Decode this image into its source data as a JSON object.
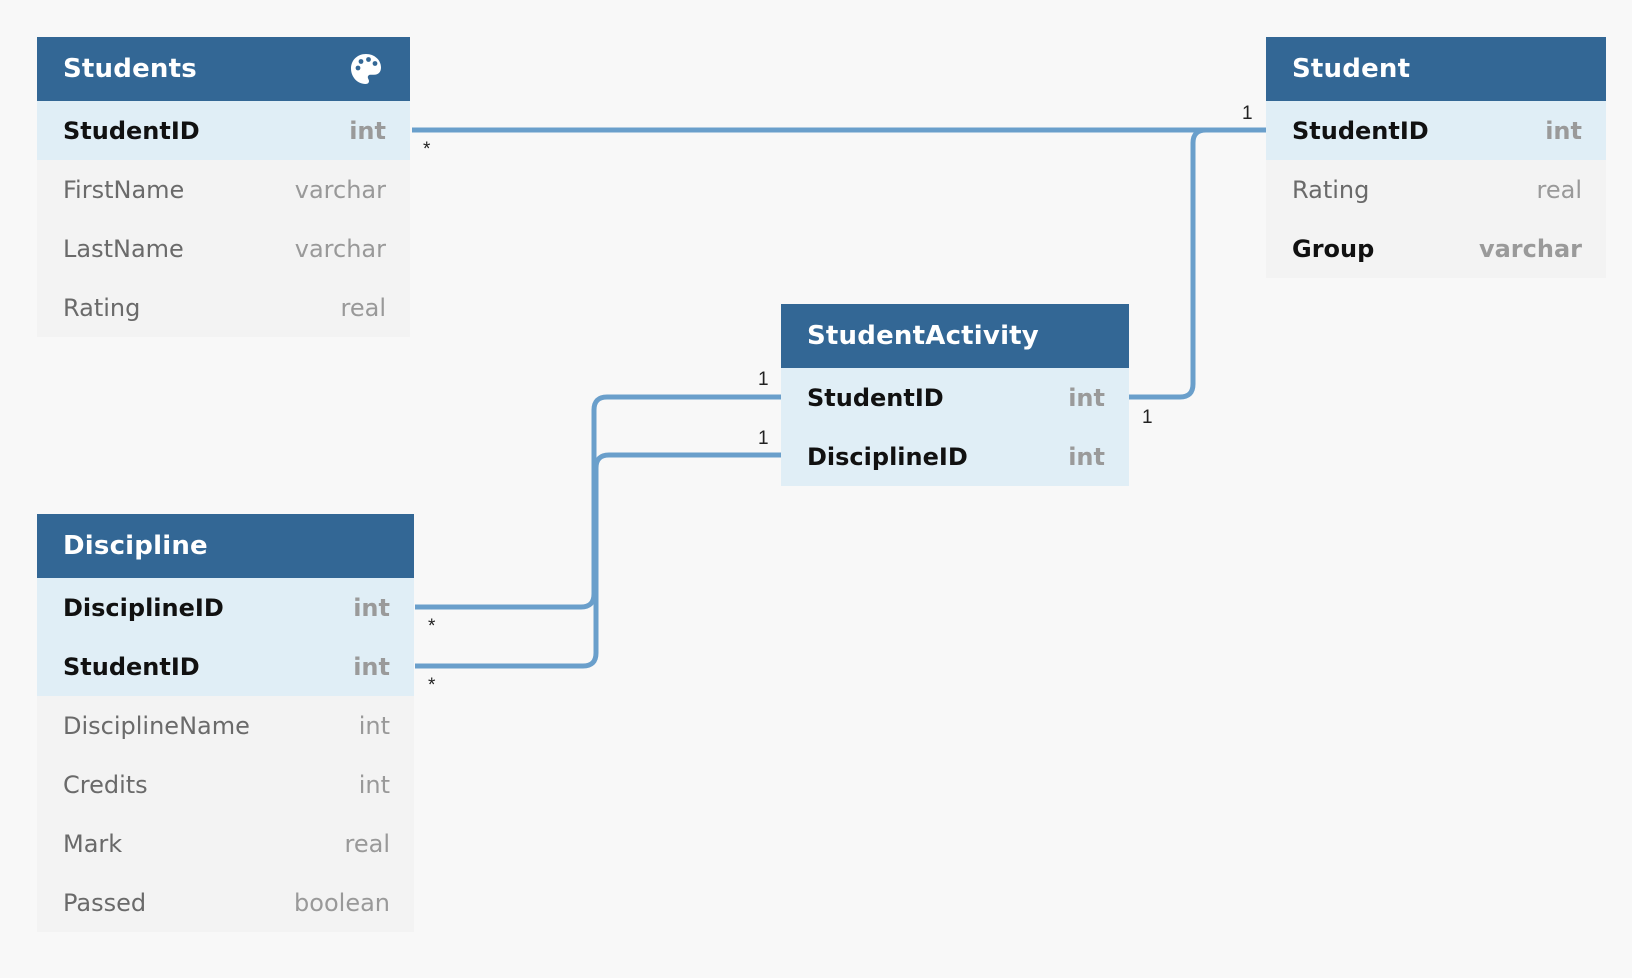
{
  "tables": [
    {
      "id": "students",
      "title": "Students",
      "fields": [
        {
          "name": "StudentID",
          "type": "int",
          "key": true,
          "bold": true
        },
        {
          "name": "FirstName",
          "type": "varchar",
          "key": false,
          "bold": false
        },
        {
          "name": "LastName",
          "type": "varchar",
          "key": false,
          "bold": false
        },
        {
          "name": "Rating",
          "type": "real",
          "key": false,
          "bold": false
        }
      ]
    },
    {
      "id": "student",
      "title": "Student",
      "fields": [
        {
          "name": "StudentID",
          "type": "int",
          "key": true,
          "bold": true
        },
        {
          "name": "Rating",
          "type": "real",
          "key": false,
          "bold": false
        },
        {
          "name": "Group",
          "type": "varchar",
          "key": false,
          "bold": true
        }
      ]
    },
    {
      "id": "studentactivity",
      "title": "StudentActivity",
      "fields": [
        {
          "name": "StudentID",
          "type": "int",
          "key": true,
          "bold": true
        },
        {
          "name": "DisciplineID",
          "type": "int",
          "key": true,
          "bold": true
        }
      ]
    },
    {
      "id": "discipline",
      "title": "Discipline",
      "fields": [
        {
          "name": "DisciplineID",
          "type": "int",
          "key": true,
          "bold": true
        },
        {
          "name": "StudentID",
          "type": "int",
          "key": true,
          "bold": true
        },
        {
          "name": "DisciplineName",
          "type": "int",
          "key": false,
          "bold": false
        },
        {
          "name": "Credits",
          "type": "int",
          "key": false,
          "bold": false
        },
        {
          "name": "Mark",
          "type": "real",
          "key": false,
          "bold": false
        },
        {
          "name": "Passed",
          "type": "boolean",
          "key": false,
          "bold": false
        }
      ]
    }
  ],
  "relations": [
    {
      "from": "Students.StudentID",
      "to": "Student.StudentID",
      "from_card": "*",
      "to_card": "1"
    },
    {
      "from": "StudentActivity.StudentID",
      "to": "Student.StudentID",
      "from_card": "1",
      "to_card": "1"
    },
    {
      "from": "Discipline.DisciplineID",
      "to": "StudentActivity.StudentID",
      "from_card": "*",
      "to_card": "1"
    },
    {
      "from": "Discipline.StudentID",
      "to": "StudentActivity.DisciplineID",
      "from_card": "*",
      "to_card": "1"
    }
  ],
  "icons": {
    "students_header": "palette-icon"
  },
  "colors": {
    "header": "#336795",
    "key_row": "#e0eef6",
    "plain_row": "#f3f3f3",
    "relation_line": "#6a9fcb",
    "background": "#f8f8f8"
  }
}
